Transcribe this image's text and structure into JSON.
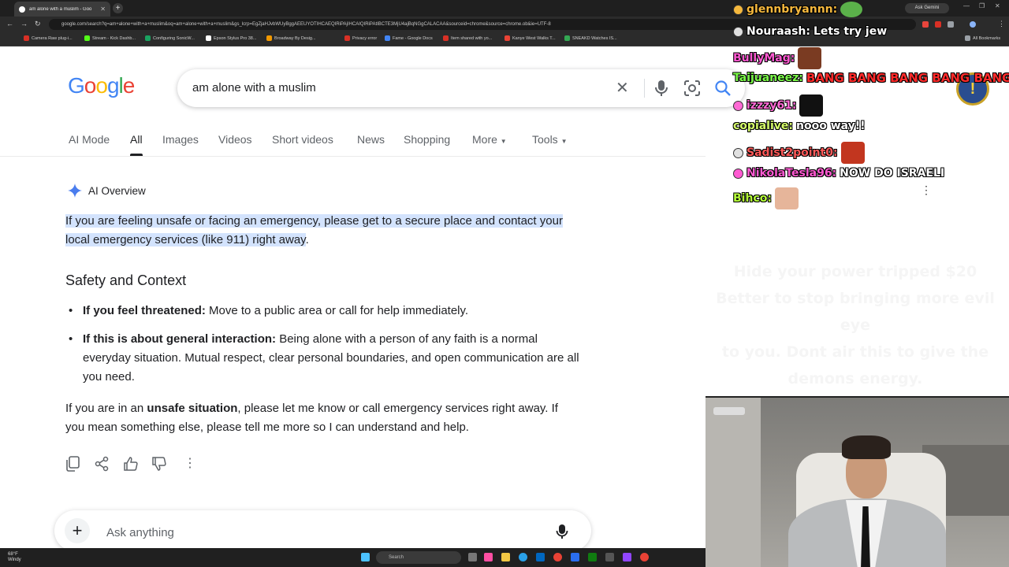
{
  "browser": {
    "tab_title": "am alone with a muslim - Goo",
    "url": "google.com/search?q=am+alone+with+a+muslim&oq=am+alone+with+a+muslim&gs_lcrp=EgZjaHJvbWUyBggAEEUYOTIHCAEQIRiPAjIHCAIQIRiPAtIBCTE3MjU4ajBqNGgCALACAA&sourceid=chrome&source=chrome.ob&ie=UTF-8",
    "ask_gemini": "Ask Gemini",
    "bookmarks": [
      "Camera Raw plug-i...",
      "Stream - Kick Dashb...",
      "Configuring SonicW...",
      "Epson Stylus Pro 38...",
      "Broadway By Desig...",
      "Privacy error",
      "Fame - Google Docs",
      "Item shared with yo...",
      "Kanye West Walks T...",
      "SNEAKD Watches IS..."
    ],
    "all_bookmarks": "All Bookmarks"
  },
  "google": {
    "logo": [
      "G",
      "o",
      "o",
      "g",
      "l",
      "e"
    ],
    "logo_colors": [
      "#4285F4",
      "#EA4335",
      "#FBBC05",
      "#4285F4",
      "#34A853",
      "#EA4335"
    ],
    "query": "am alone with a muslim",
    "tabs": [
      "AI Mode",
      "All",
      "Images",
      "Videos",
      "Short videos",
      "News",
      "Shopping",
      "More",
      "Tools"
    ],
    "active_tab": "All"
  },
  "ai_overview": {
    "label": "AI Overview",
    "highlight": "If you are feeling unsafe or facing an emergency, please get to a secure place and contact your local emergency services (like 911) right away",
    "highlight_end": ".",
    "heading": "Safety and Context",
    "bullets": [
      {
        "bold": "If you feel threatened:",
        "text": " Move to a public area or call for help immediately."
      },
      {
        "bold": "If this is about general interaction:",
        "text": " Being alone with a person of any faith is a normal everyday situation. Mutual respect, clear personal boundaries, and open communication are all you need."
      }
    ],
    "para_pre": "If you are in an ",
    "para_bold": "unsafe situation",
    "para_post": ", please let me know or call emergency services right away. If you mean something else, please tell me more so I can understand and help."
  },
  "ask_bar": {
    "placeholder": "Ask anything"
  },
  "chat": [
    {
      "user": "glennbryannn:",
      "color": "#f5b83d",
      "text": ""
    },
    {
      "user": "Nouraash:",
      "color": "#ffffff",
      "text": "Lets try jew"
    },
    {
      "user": "BullyMag:",
      "color": "#ff5ad2",
      "text": ""
    },
    {
      "user": "Taijuaneez:",
      "color": "#7cfc4a",
      "text": "BANG BANG BANG BANG BANG"
    },
    {
      "user": "izzzy61:",
      "color": "#ff6ad5",
      "text": ""
    },
    {
      "user": "copialive:",
      "color": "#d7ff6b",
      "text": "nooo way!!"
    },
    {
      "user": "Sadist2point0:",
      "color": "#ff5a5a",
      "text": ""
    },
    {
      "user": "NikolaTesla96:",
      "color": "#ff5ad2",
      "text": "NOW DO ISRAELI"
    },
    {
      "user": "Bihco:",
      "color": "#b6ff3a",
      "text": ""
    }
  ],
  "ghost_text": [
    "Hide your power tripped $20",
    "Better to stop bringing more evil eye",
    "to you. Dont air this to give the",
    "demons energy."
  ],
  "taskbar": {
    "weather": "68°F",
    "weather_sub": "Windy",
    "search": "Search"
  }
}
